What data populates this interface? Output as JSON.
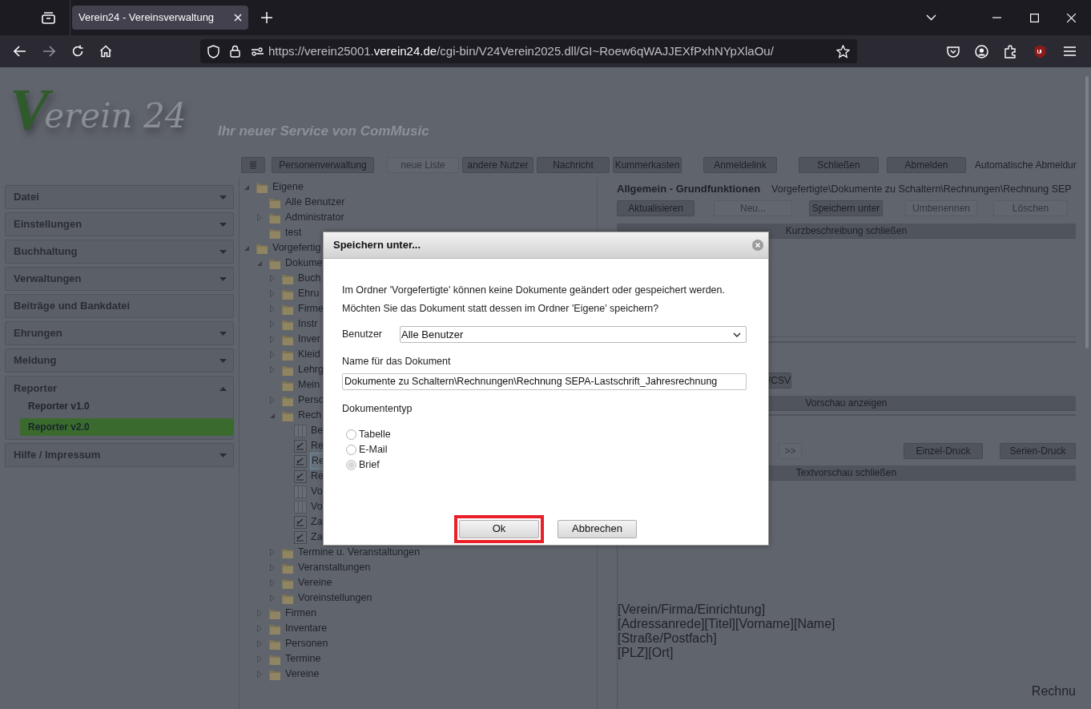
{
  "browser": {
    "tab": {
      "title": "Verein24 - Vereinsverwaltung",
      "selected": true
    },
    "url": {
      "prefix": "https://verein25001.",
      "domain": "verein24.de",
      "path": "/cgi-bin/V24Verein2025.dll/GI~Roew6qWAJJEXfPxhNYpXlaOu/"
    }
  },
  "header": {
    "logo": {
      "initial": "V",
      "rest": "erein 24"
    },
    "tagline": "Ihr neuer Service von ComMusic"
  },
  "toolbar": {
    "buttons": [
      {
        "label": "Personenverwaltung",
        "disabled": false
      },
      {
        "label": "neue Liste",
        "disabled": true
      },
      {
        "label": "andere Nutzer",
        "disabled": false
      },
      {
        "label": "Nachricht",
        "disabled": false
      },
      {
        "label": "Kummerkasten",
        "disabled": false
      },
      {
        "label": "Anmeldelink",
        "disabled": false
      },
      {
        "label": "Schließen",
        "disabled": false
      },
      {
        "label": "Abmelden",
        "disabled": false
      }
    ],
    "note": "Automatische Abmeldur"
  },
  "sidebar": {
    "items": [
      {
        "label": "Datei",
        "expanded": false
      },
      {
        "label": "Einstellungen",
        "expanded": false
      },
      {
        "label": "Buchhaltung",
        "expanded": false
      },
      {
        "label": "Verwaltungen",
        "expanded": false
      },
      {
        "label": "Beiträge und Bankdatei"
      },
      {
        "label": "Ehrungen",
        "expanded": false
      },
      {
        "label": "Meldung",
        "expanded": false
      },
      {
        "label": "Reporter",
        "expanded": true,
        "children": [
          {
            "label": "Reporter v1.0",
            "selected": false
          },
          {
            "label": "Reporter v2.0",
            "selected": true
          }
        ]
      },
      {
        "label": "Hilfe / Impressum",
        "expanded": false
      }
    ]
  },
  "tree": [
    {
      "label": "Eigene",
      "kind": "folder",
      "expanded": true,
      "children": [
        {
          "label": "Alle Benutzer",
          "kind": "folder"
        },
        {
          "label": "Administrator",
          "kind": "folder",
          "expanded": false
        },
        {
          "label": "test",
          "kind": "folder"
        }
      ]
    },
    {
      "label": "Vorgefertig",
      "kind": "folder",
      "expanded": true,
      "children": [
        {
          "label": "Dokume",
          "kind": "folder",
          "expanded": true,
          "children": [
            {
              "label": "Buch",
              "kind": "folder",
              "expanded": false
            },
            {
              "label": "Ehru",
              "kind": "folder",
              "expanded": false
            },
            {
              "label": "Firme",
              "kind": "folder",
              "expanded": false
            },
            {
              "label": "Instr",
              "kind": "folder",
              "expanded": false
            },
            {
              "label": "Inver",
              "kind": "folder",
              "expanded": false
            },
            {
              "label": "Kleid",
              "kind": "folder",
              "expanded": false
            },
            {
              "label": "Lehrg",
              "kind": "folder",
              "expanded": false
            },
            {
              "label": "Mein",
              "kind": "folder"
            },
            {
              "label": "Perso",
              "kind": "folder",
              "expanded": false
            },
            {
              "label": "Rech",
              "kind": "folder",
              "expanded": true,
              "children": [
                {
                  "label": "Be",
                  "kind": "table",
                  "selected": false
                },
                {
                  "label": "Re",
                  "kind": "letter",
                  "selected": false
                },
                {
                  "label": "Re",
                  "kind": "letter",
                  "selected": true
                },
                {
                  "label": "Re",
                  "kind": "letter",
                  "selected": false
                },
                {
                  "label": "Vo",
                  "kind": "table",
                  "selected": false
                },
                {
                  "label": "Vo",
                  "kind": "table",
                  "selected": false
                },
                {
                  "label": "Za",
                  "kind": "letter",
                  "selected": false
                },
                {
                  "label": "Za",
                  "kind": "letter",
                  "selected": false
                }
              ]
            },
            {
              "label": "Termine u. Veranstaltungen",
              "kind": "folder",
              "expanded": false
            },
            {
              "label": "Veranstaltungen",
              "kind": "folder",
              "expanded": false
            },
            {
              "label": "Vereine",
              "kind": "folder",
              "expanded": false
            },
            {
              "label": "Voreinstellungen",
              "kind": "folder",
              "expanded": false
            }
          ]
        },
        {
          "label": "Firmen",
          "kind": "folder",
          "expanded": false
        },
        {
          "label": "Inventare",
          "kind": "folder",
          "expanded": false
        },
        {
          "label": "Personen",
          "kind": "folder",
          "expanded": false
        },
        {
          "label": "Termine",
          "kind": "folder",
          "expanded": false
        },
        {
          "label": "Vereine",
          "kind": "folder",
          "expanded": false
        }
      ]
    }
  ],
  "panel": {
    "title": "Allgemein - Grundfunktionen",
    "path": "Vorgefertigte\\Dokumente zu Schaltern\\Rechnungen\\Rechnung SEP",
    "buttons": [
      {
        "label": "Aktualisieren",
        "disabled": false
      },
      {
        "label": "Neu...",
        "disabled": true
      },
      {
        "label": "Speichern unter",
        "disabled": false
      },
      {
        "label": "Umbenennen",
        "disabled": true
      },
      {
        "label": "Löschen",
        "disabled": true
      }
    ],
    "description_toggle": "Kurzbeschreibung schließen",
    "format_button": "/CSV",
    "preview_toggle": "Vorschau anzeigen",
    "next_button": ">>",
    "print_buttons": [
      "Einzel-Druck",
      "Serien-Druck"
    ],
    "text_preview_toggle": "Textvorschau schließen",
    "preview_lines": [
      "[Verein/Firma/Einrichtung]",
      "[Adressanrede][Titel][Vorname][Name]",
      "[Straße/Postfach]",
      "[PLZ][Ort]"
    ],
    "preview_heading": "Rechnu"
  },
  "dialog": {
    "title": "Speichern unter...",
    "message": [
      "Im Ordner 'Vorgefertigte' können keine Dokumente geändert oder gespeichert werden.",
      "Möchten Sie das Dokument statt dessen im Ordner 'Eigene' speichern?"
    ],
    "user_label": "Benutzer",
    "user_value": "Alle Benutzer",
    "name_label": "Name für das Dokument",
    "name_value": "Dokumente zu Schaltern\\Rechnungen\\Rechnung SEPA-Lastschrift_Jahresrechnung",
    "type_label": "Dokumententyp",
    "types": [
      {
        "label": "Tabelle",
        "selected": false
      },
      {
        "label": "E-Mail",
        "selected": false
      },
      {
        "label": "Brief",
        "selected": true
      }
    ],
    "buttons": [
      {
        "label": "Ok",
        "highlighted": true
      },
      {
        "label": "Abbrechen",
        "highlighted": false
      }
    ]
  }
}
